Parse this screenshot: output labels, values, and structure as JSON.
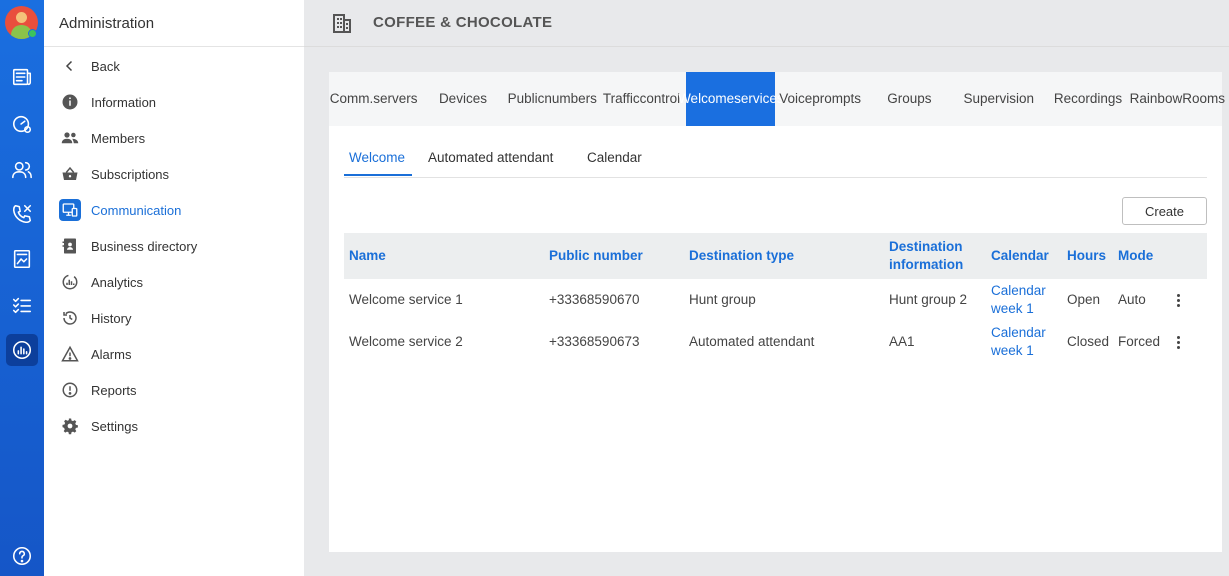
{
  "app": {
    "panel_title": "Administration",
    "organization": "COFFEE & CHOCOLATE"
  },
  "rail": {
    "icons": [
      "avatar",
      "news-icon",
      "dashboard-icon",
      "contacts-icon",
      "phone-icon",
      "document-icon",
      "tasks-icon",
      "analytics-icon",
      "help-icon"
    ],
    "active": "analytics-icon",
    "accent": "#1a6fe0"
  },
  "sidebar": {
    "items": [
      {
        "label": "Back",
        "icon": "chevron-left-icon"
      },
      {
        "label": "Information",
        "icon": "info-icon"
      },
      {
        "label": "Members",
        "icon": "members-icon"
      },
      {
        "label": "Subscriptions",
        "icon": "basket-icon"
      },
      {
        "label": "Communication",
        "icon": "communication-icon",
        "active": true
      },
      {
        "label": "Business directory",
        "icon": "directory-icon"
      },
      {
        "label": "Analytics",
        "icon": "analytics-icon"
      },
      {
        "label": "History",
        "icon": "history-icon"
      },
      {
        "label": "Alarms",
        "icon": "alarm-icon"
      },
      {
        "label": "Reports",
        "icon": "report-icon"
      },
      {
        "label": "Settings",
        "icon": "settings-icon"
      }
    ]
  },
  "tabs": [
    {
      "line1": "Comm.",
      "line2": "servers"
    },
    {
      "line1": "Devices",
      "line2": ""
    },
    {
      "line1": "Public",
      "line2": "numbers"
    },
    {
      "line1": "Traffic",
      "line2": "control"
    },
    {
      "line1": "Welcome",
      "line2": "services",
      "active": true
    },
    {
      "line1": "Voice",
      "line2": "prompts"
    },
    {
      "line1": "Groups",
      "line2": ""
    },
    {
      "line1": "Supervision",
      "line2": ""
    },
    {
      "line1": "Recordings",
      "line2": ""
    },
    {
      "line1": "Rainbow",
      "line2": "Rooms"
    }
  ],
  "subtabs": [
    {
      "label": "Welcome",
      "active": true
    },
    {
      "label": "Automated attendant"
    },
    {
      "label": "Calendar"
    }
  ],
  "actions": {
    "create_label": "Create"
  },
  "table": {
    "headers": {
      "name": "Name",
      "public_number": "Public number",
      "destination_type": "Destination type",
      "destination_info_1": "Destination",
      "destination_info_2": "information",
      "calendar": "Calendar",
      "hours": "Hours",
      "mode": "Mode"
    },
    "rows": [
      {
        "name": "Welcome service 1",
        "public_number": "+33368590670",
        "destination_type": "Hunt group",
        "destination_info": "Hunt group 2",
        "calendar_1": "Calendar",
        "calendar_2": "week 1",
        "hours": "Open",
        "mode": "Auto"
      },
      {
        "name": "Welcome service 2",
        "public_number": "+33368590673",
        "destination_type": "Automated attendant",
        "destination_info": "AA1",
        "calendar_1": "Calendar",
        "calendar_2": "week 1",
        "hours": "Closed",
        "mode": "Forced"
      }
    ]
  }
}
